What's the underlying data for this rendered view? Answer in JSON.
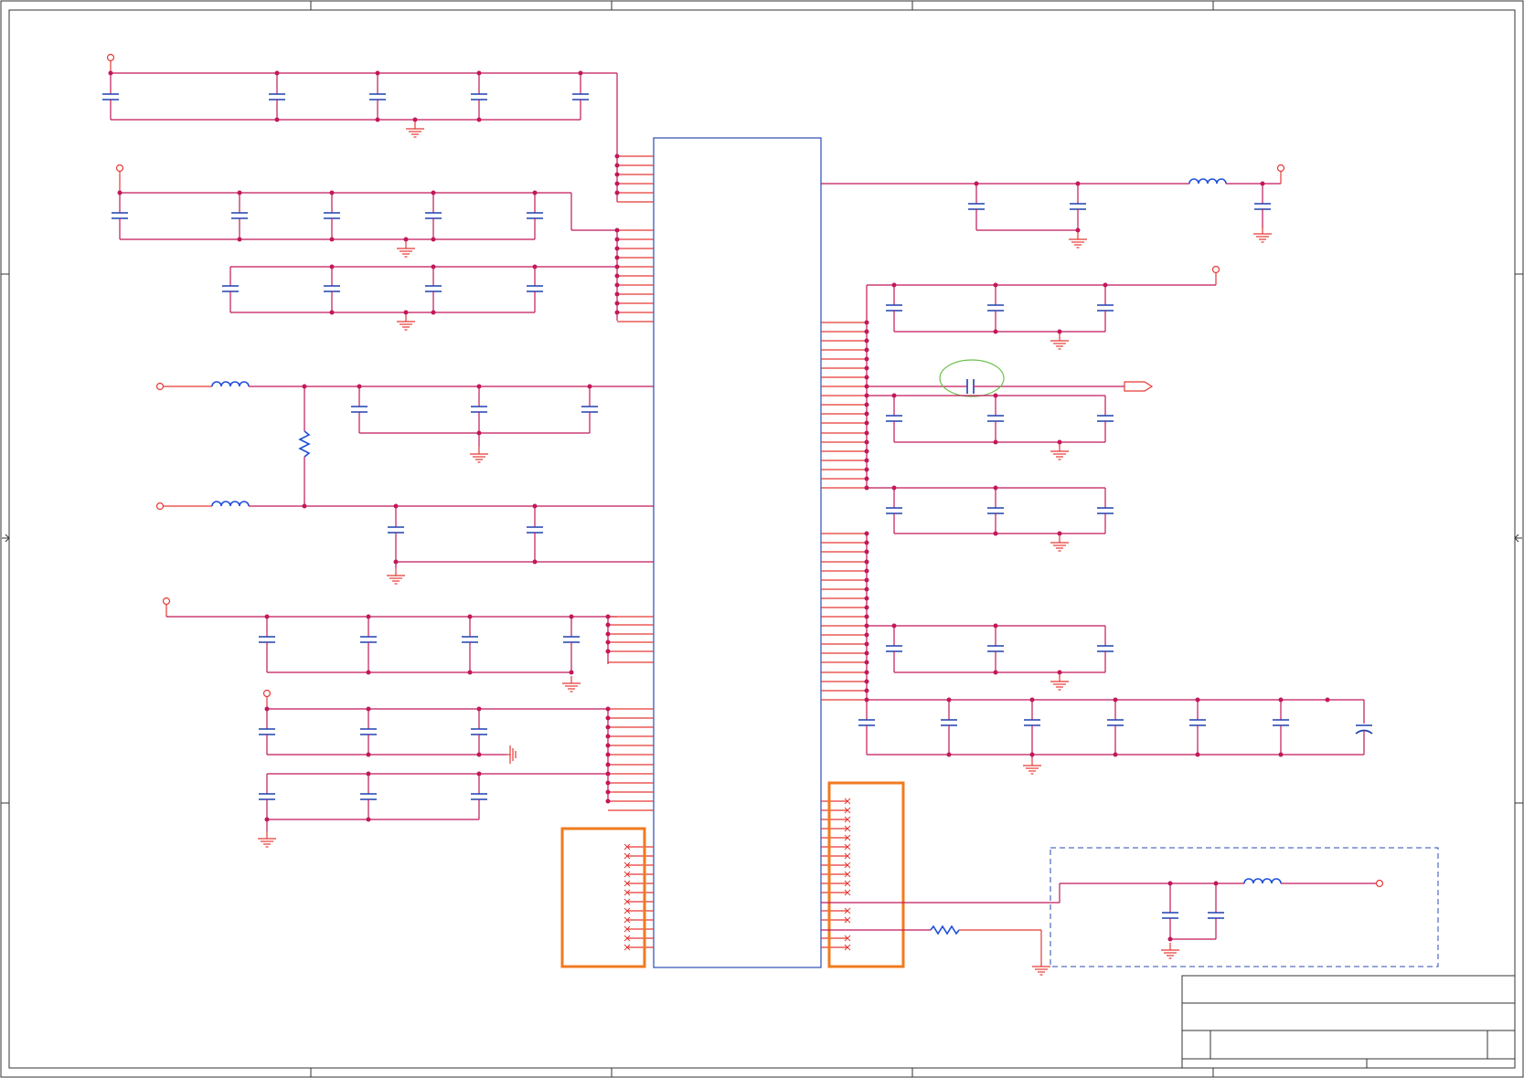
{
  "diagram": {
    "type": "schematic",
    "colors": {
      "wire": "#c2185b",
      "wire_red": "#e53935",
      "component": "#1e40af",
      "ic_outline": "#2b4bb5",
      "highlight_box": "#f07a1f",
      "highlight_ellipse": "#6cc04a",
      "dashed_region": "#2b4bb5",
      "frame": "#333333"
    },
    "icons": [
      "capacitor-icon",
      "inductor-icon",
      "resistor-icon",
      "ground-icon",
      "power-port-icon",
      "offpage-connector-icon",
      "no-connect-icon"
    ],
    "highlights": [
      "left-nc-pin-group",
      "right-nc-pin-group",
      "bypass-capacitor"
    ]
  },
  "title_block": {
    "title": "",
    "size": "",
    "sheet": ""
  }
}
